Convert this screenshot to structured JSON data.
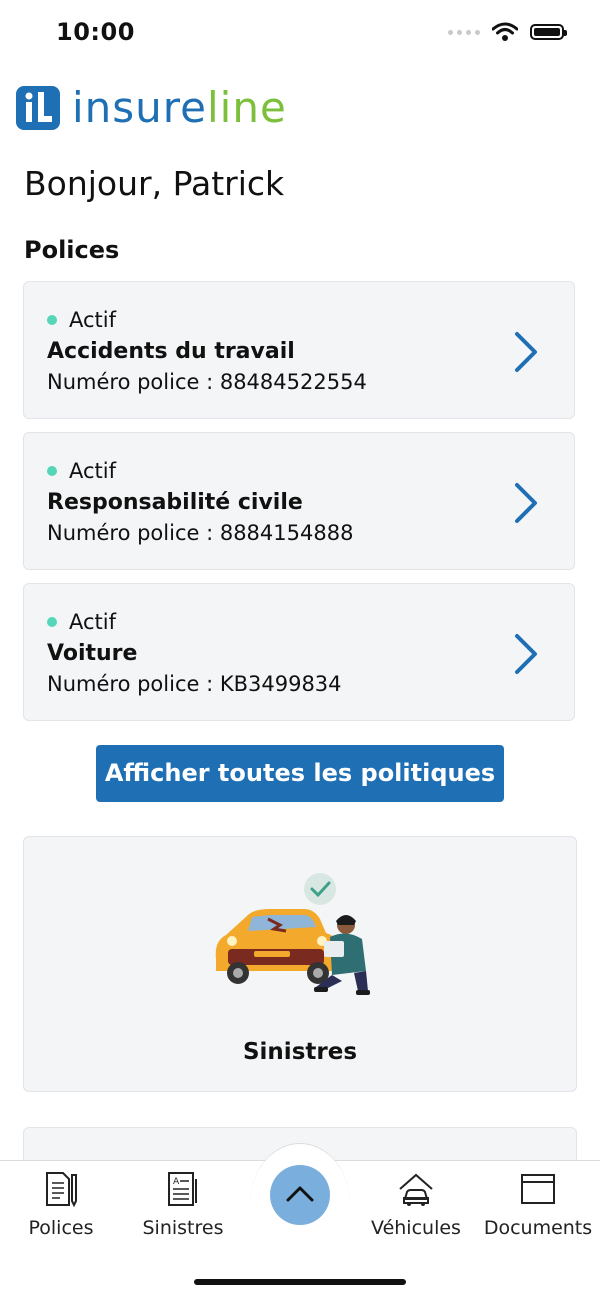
{
  "status_bar": {
    "time": "10:00"
  },
  "brand": {
    "part1": "insure",
    "part2": "line",
    "primary_color": "#1f6fb5",
    "secondary_color": "#7bbf3a"
  },
  "greeting": "Bonjour, Patrick",
  "policies": {
    "title": "Polices",
    "items": [
      {
        "status": "Actif",
        "name": "Accidents du travail",
        "number": "Numéro police : 88484522554"
      },
      {
        "status": "Actif",
        "name": "Responsabilité civile",
        "number": "Numéro police : 8884154888"
      },
      {
        "status": "Actif",
        "name": "Voiture",
        "number": "Numéro police : KB3499834"
      }
    ],
    "view_all_label": "Afficher toutes les politiques"
  },
  "claims_card": {
    "label": "Sinistres",
    "illustration": "car-inspection-illustration"
  },
  "tab_bar": {
    "items": [
      {
        "label": "Polices",
        "icon": "document-pen-icon"
      },
      {
        "label": "Sinistres",
        "icon": "claim-form-icon"
      },
      {
        "label": "Véhicules",
        "icon": "car-home-icon"
      },
      {
        "label": "Documents",
        "icon": "folder-icon"
      }
    ],
    "center_button_icon": "chevron-up-icon"
  },
  "colors": {
    "status_active": "#55d6b8",
    "accent": "#1f6fb5",
    "fab": "#79aedd"
  }
}
